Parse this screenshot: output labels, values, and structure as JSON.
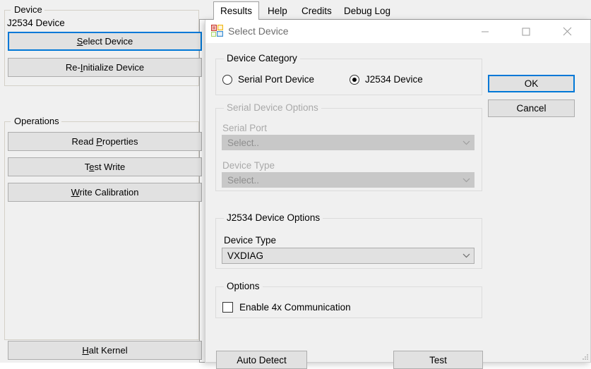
{
  "background_app": {
    "tabs": [
      {
        "label": "Results",
        "active": true
      },
      {
        "label": "Help",
        "active": false
      },
      {
        "label": "Credits",
        "active": false
      },
      {
        "label": "Debug Log",
        "active": false
      }
    ],
    "device_group": {
      "label": "Device",
      "status_text": "J2534 Device",
      "buttons": [
        {
          "label": "Select Device",
          "mnemonic": "S",
          "focused": true
        },
        {
          "label": "Re-Initialize Device",
          "mnemonic": "I",
          "focused": false
        }
      ]
    },
    "operations_group": {
      "label": "Operations",
      "buttons": [
        {
          "label": "Read Properties",
          "mnemonic": "P"
        },
        {
          "label": "Test Write",
          "mnemonic": "e"
        },
        {
          "label": "Write Calibration",
          "mnemonic": "W"
        }
      ]
    },
    "halt_button": {
      "label": "Halt Kernel",
      "mnemonic": "H"
    }
  },
  "dialog": {
    "title": "Select Device",
    "icon": "application-window-icon",
    "window_controls": {
      "minimize": "minimize-icon",
      "maximize": "maximize-icon",
      "close": "close-icon"
    },
    "device_category": {
      "label": "Device Category",
      "options": [
        {
          "label": "Serial Port Device",
          "selected": false
        },
        {
          "label": "J2534 Device",
          "selected": true
        }
      ]
    },
    "serial_device_options": {
      "label": "Serial Device Options",
      "enabled": false,
      "fields": [
        {
          "label": "Serial Port",
          "value": "Select.."
        },
        {
          "label": "Device Type",
          "value": "Select.."
        }
      ]
    },
    "j2534_device_options": {
      "label": "J2534 Device Options",
      "enabled": true,
      "fields": [
        {
          "label": "Device Type",
          "value": "VXDIAG"
        }
      ]
    },
    "options_group": {
      "label": "Options",
      "checkbox": {
        "label": "Enable 4x Communication",
        "checked": false
      }
    },
    "action_buttons": {
      "auto_detect": "Auto Detect",
      "test": "Test"
    },
    "right_buttons": {
      "ok": {
        "label": "OK",
        "focused": true
      },
      "cancel": {
        "label": "Cancel",
        "focused": false
      }
    }
  },
  "colors": {
    "accent_focus": "#0078d7",
    "dialog_bg": "#f0f0f0",
    "button_face": "#e1e1e1",
    "disabled_text": "#a9a9a9",
    "title_text": "#6d6d6d"
  }
}
